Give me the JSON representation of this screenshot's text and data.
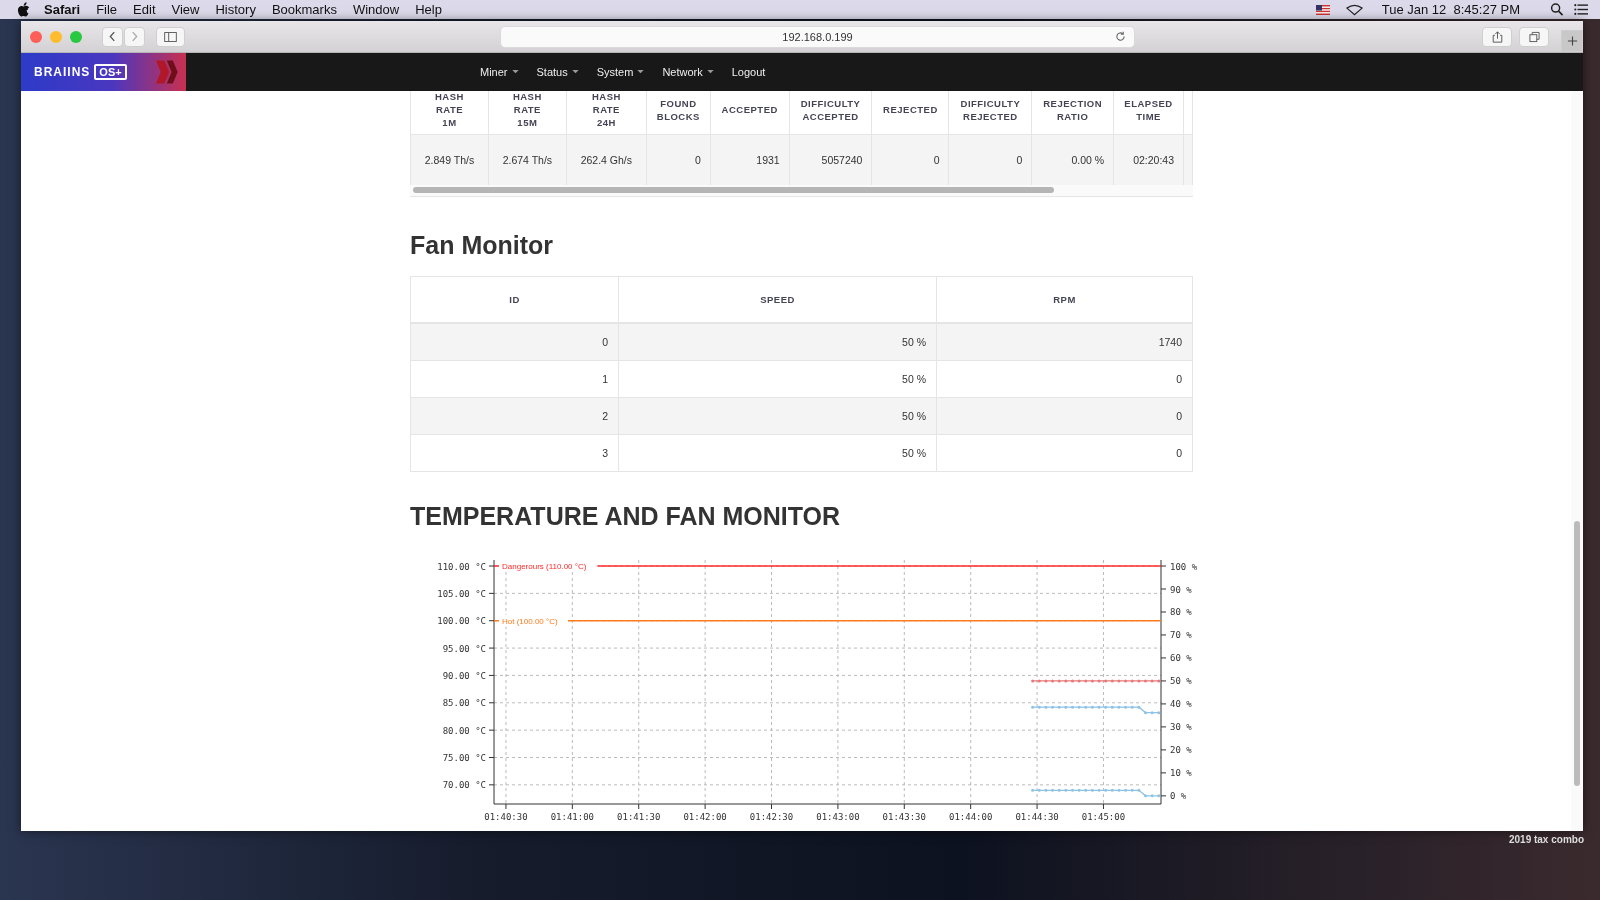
{
  "menubar": {
    "app": "Safari",
    "items": [
      "File",
      "Edit",
      "View",
      "History",
      "Bookmarks",
      "Window",
      "Help"
    ],
    "clock": "Tue Jan 12  8:45:27 PM"
  },
  "browser": {
    "url": "192.168.0.199"
  },
  "navbar": {
    "logo": "BRAIINS",
    "logo_badge": "OS+",
    "items": [
      {
        "label": "Miner",
        "dropdown": true
      },
      {
        "label": "Status",
        "dropdown": true
      },
      {
        "label": "System",
        "dropdown": true
      },
      {
        "label": "Network",
        "dropdown": true
      },
      {
        "label": "Logout",
        "dropdown": false
      }
    ]
  },
  "stats_table": {
    "columns": [
      [
        "HASH",
        "RATE",
        "1M"
      ],
      [
        "HASH",
        "RATE",
        "15M"
      ],
      [
        "HASH",
        "RATE",
        "24H"
      ],
      [
        "FOUND",
        "BLOCKS"
      ],
      [
        "ACCEPTED"
      ],
      [
        "DIFFICULTY",
        "ACCEPTED"
      ],
      [
        "REJECTED"
      ],
      [
        "DIFFICULTY",
        "REJECTED"
      ],
      [
        "REJECTION",
        "RATIO"
      ],
      [
        "ELAPSED",
        "TIME"
      ]
    ],
    "row": [
      "2.849 Th/s",
      "2.674 Th/s",
      "262.4 Gh/s",
      "0",
      "1931",
      "5057240",
      "0",
      "0",
      "0.00 %",
      "02:20:43"
    ]
  },
  "fan_monitor": {
    "title": "Fan Monitor",
    "columns": [
      "ID",
      "SPEED",
      "RPM"
    ],
    "rows": [
      [
        "0",
        "50 %",
        "1740"
      ],
      [
        "1",
        "50 %",
        "0"
      ],
      [
        "2",
        "50 %",
        "0"
      ],
      [
        "3",
        "50 %",
        "0"
      ]
    ]
  },
  "temperature": {
    "title": "TEMPERATURE AND FAN MONITOR",
    "chart_data": {
      "type": "line",
      "x": [
        6268,
        6271,
        6274,
        6277,
        6280,
        6283,
        6286,
        6289,
        6292,
        6295,
        6298,
        6301,
        6304,
        6307,
        6310,
        6313,
        6316,
        6319,
        6322,
        6325
      ],
      "xlim": [
        6024.6,
        6326
      ],
      "ylim": [
        66.5,
        111.1
      ],
      "xticks": [
        {
          "value": 6030,
          "label": "01:40:30"
        },
        {
          "value": 6060,
          "label": "01:41:00"
        },
        {
          "value": 6090,
          "label": "01:41:30"
        },
        {
          "value": 6120,
          "label": "01:42:00"
        },
        {
          "value": 6150,
          "label": "01:42:30"
        },
        {
          "value": 6180,
          "label": "01:43:00"
        },
        {
          "value": 6210,
          "label": "01:43:30"
        },
        {
          "value": 6240,
          "label": "01:44:00"
        },
        {
          "value": 6270,
          "label": "01:44:30"
        },
        {
          "value": 6300,
          "label": "01:45:00"
        }
      ],
      "yticks": [
        {
          "value": 110,
          "label": "110.00 °C"
        },
        {
          "value": 105,
          "label": "105.00 °C"
        },
        {
          "value": 100,
          "label": "100.00 °C"
        },
        {
          "value": 95,
          "label": "95.00 °C"
        },
        {
          "value": 90,
          "label": "90.00 °C"
        },
        {
          "value": 85,
          "label": "85.00 °C"
        },
        {
          "value": 80,
          "label": "80.00 °C"
        },
        {
          "value": 75,
          "label": "75.00 °C"
        },
        {
          "value": 70,
          "label": "70.00 °C"
        }
      ],
      "y2ticks": [
        "100 %",
        "90 %",
        "80 %",
        "70 %",
        "60 %",
        "50 %",
        "40 %",
        "30 %",
        "20 %",
        "10 %",
        "0 %"
      ],
      "series": [
        {
          "color": "#8ec3e6",
          "values": [
            84.2,
            84.2,
            84.2,
            84.2,
            84.2,
            84.2,
            84.2,
            84.2,
            84.2,
            84.2,
            84.2,
            84.2,
            84.2,
            84.2,
            84.2,
            84.2,
            84.2,
            83.2,
            83.2,
            83.2
          ]
        },
        {
          "color": "#8ec3e6",
          "values": [
            69.0,
            69.0,
            69.0,
            69.0,
            69.0,
            69.0,
            69.0,
            69.0,
            69.0,
            69.0,
            69.0,
            69.0,
            69.0,
            69.0,
            69.0,
            69.0,
            69.0,
            68.0,
            68.0,
            68.0
          ]
        },
        {
          "color": "#e8797a",
          "values": [
            89.0,
            89.0,
            89.0,
            89.0,
            89.0,
            89.0,
            89.0,
            89.0,
            89.0,
            89.0,
            89.0,
            89.0,
            89.0,
            89.0,
            89.0,
            89.0,
            89.0,
            89.0,
            89.0,
            89.0
          ]
        }
      ],
      "grid": true,
      "ref_lines": [
        {
          "axis": "y",
          "value": 110,
          "label": "Dangerours (110.00 °C)",
          "color": "#ff2a2a"
        },
        {
          "axis": "y",
          "value": 100,
          "label": "Hot (100.00 °C)",
          "color": "#ff7a1a"
        }
      ]
    }
  },
  "desktop": {
    "icon_label": "2019 tax combo"
  }
}
